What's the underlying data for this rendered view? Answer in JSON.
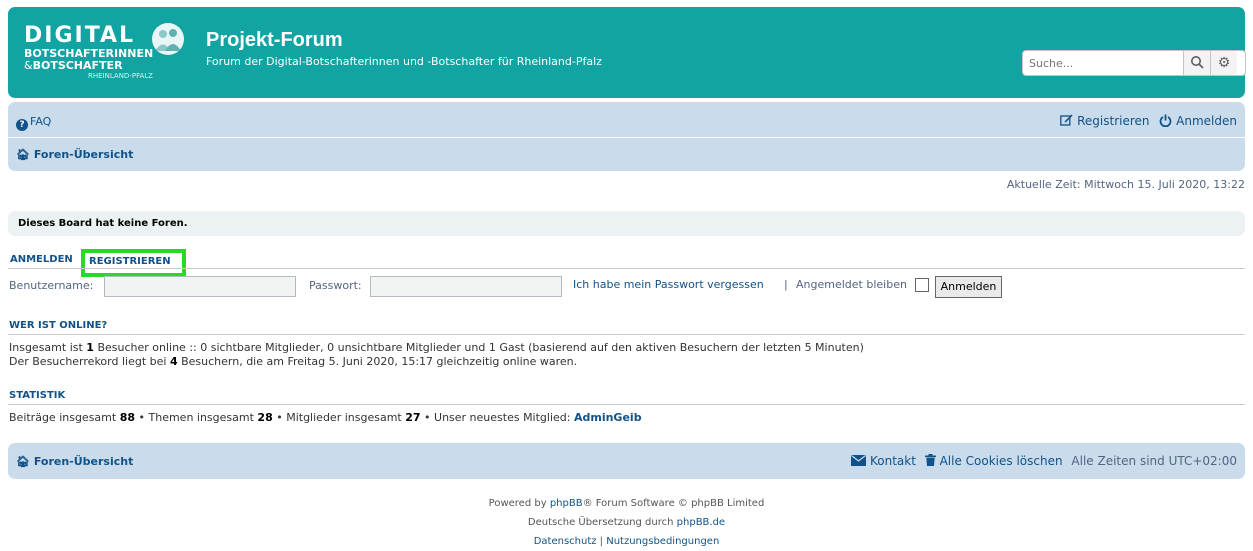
{
  "header": {
    "logo": {
      "line1": "DIGITAL",
      "line2": "BOTSCHAFTERINNEN",
      "line3_prefix": "&",
      "line3": "BOTSCHAFTER",
      "line4": "RHEINLAND-PFALZ"
    },
    "site_title": "Projekt-Forum",
    "site_description": "Forum der Digital-Botschafterinnen und -Botschafter für Rheinland-Pfalz",
    "search": {
      "placeholder": "Suche...",
      "search_icon": "search-icon",
      "advanced_icon": "gear-icon"
    }
  },
  "navbar": {
    "faq": "FAQ",
    "register": "Registrieren",
    "login": "Anmelden",
    "breadcrumb": "Foren-Übersicht"
  },
  "time_text": "Aktuelle Zeit: Mittwoch 15. Juli 2020, 13:22",
  "notice": "Dieses Board hat keine Foren.",
  "login_form": {
    "tab_login": "ANMELDEN",
    "tab_register": "REGISTRIEREN",
    "username_label": "Benutzername:",
    "username_value": "",
    "password_label": "Passwort:",
    "password_value": "",
    "forgot_link": "Ich habe mein Passwort vergessen",
    "separator": "|",
    "remember_label": "Angemeldet bleiben",
    "remember_checked": false,
    "submit": "Anmelden"
  },
  "online": {
    "title": "WER IST ONLINE?",
    "line1_a": "Insgesamt ist ",
    "line1_count": "1",
    "line1_b": " Besucher online :: 0 sichtbare Mitglieder, 0 unsichtbare Mitglieder und 1 Gast (basierend auf den aktiven Besuchern der letzten 5 Minuten)",
    "line2_a": "Der Besucherrekord liegt bei ",
    "line2_count": "4",
    "line2_b": " Besuchern, die am Freitag 5. Juni 2020, 15:17 gleichzeitig online waren."
  },
  "stats": {
    "title": "STATISTIK",
    "posts_label": "Beiträge insgesamt ",
    "posts": "88",
    "topics_label": " • Themen insgesamt ",
    "topics": "28",
    "members_label": " • Mitglieder insgesamt ",
    "members": "27",
    "newest_label": " • Unser neuestes Mitglied: ",
    "newest_member": "AdminGeib"
  },
  "footer_nav": {
    "breadcrumb": "Foren-Übersicht",
    "contact": "Kontakt",
    "delete_cookies": "Alle Cookies löschen",
    "timezone": "Alle Zeiten sind UTC+02:00"
  },
  "copyright": {
    "line1_a": "Powered by ",
    "line1_link": "phpBB",
    "line1_b": "® Forum Software © phpBB Limited",
    "line2_a": "Deutsche Übersetzung durch ",
    "line2_link": "phpBB.de",
    "privacy": "Datenschutz",
    "sep": " | ",
    "terms": "Nutzungsbedingungen"
  },
  "colors": {
    "header_bg": "#12a3a3",
    "navbar_bg": "#cadceb",
    "link": "#105289",
    "highlight": "#22dd22"
  }
}
